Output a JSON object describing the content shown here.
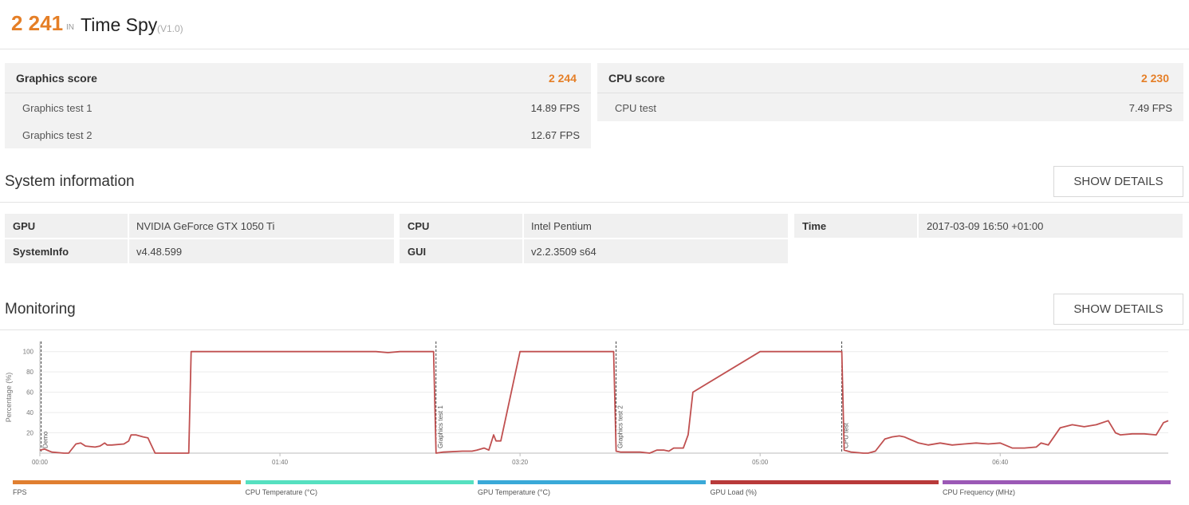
{
  "header": {
    "score": "2 241",
    "in_label": "IN",
    "title": "Time Spy",
    "version": "(V1.0)"
  },
  "graphics": {
    "label": "Graphics score",
    "value": "2 244",
    "tests": [
      {
        "label": "Graphics test 1",
        "value": "14.89 FPS"
      },
      {
        "label": "Graphics test 2",
        "value": "12.67 FPS"
      }
    ]
  },
  "cpu": {
    "label": "CPU score",
    "value": "2 230",
    "tests": [
      {
        "label": "CPU test",
        "value": "7.49 FPS"
      }
    ]
  },
  "system": {
    "title": "System information",
    "button": "SHOW DETAILS",
    "items": [
      {
        "key": "GPU",
        "value": "NVIDIA GeForce GTX 1050 Ti"
      },
      {
        "key": "CPU",
        "value": "Intel Pentium"
      },
      {
        "key": "Time",
        "value": "2017-03-09 16:50 +01:00"
      },
      {
        "key": "SystemInfo",
        "value": "v4.48.599"
      },
      {
        "key": "GUI",
        "value": "v2.2.3509 s64"
      }
    ]
  },
  "monitoring": {
    "title": "Monitoring",
    "button": "SHOW DETAILS",
    "legend": [
      {
        "label": "FPS",
        "color": "#e07f30"
      },
      {
        "label": "CPU Temperature (°C)",
        "color": "#56e0c0"
      },
      {
        "label": "GPU Temperature (°C)",
        "color": "#3aa9d8"
      },
      {
        "label": "GPU Load (%)",
        "color": "#b83a3a"
      },
      {
        "label": "CPU Frequency (MHz)",
        "color": "#9b59b6"
      }
    ]
  },
  "chart_data": {
    "type": "line",
    "ylabel": "Percentage (%)",
    "ylim": [
      0,
      110
    ],
    "yticks": [
      20,
      40,
      60,
      80,
      100
    ],
    "xlim": [
      0,
      470
    ],
    "xticks": [
      {
        "t": 0,
        "label": "00:00"
      },
      {
        "t": 100,
        "label": "01:40"
      },
      {
        "t": 200,
        "label": "03:20"
      },
      {
        "t": 300,
        "label": "05:00"
      },
      {
        "t": 400,
        "label": "06:40"
      }
    ],
    "markers": [
      {
        "t": 0.5,
        "label": "Demo"
      },
      {
        "t": 165,
        "label": "Graphics test 1"
      },
      {
        "t": 240,
        "label": "Graphics test 2"
      },
      {
        "t": 334,
        "label": "CPU test"
      }
    ],
    "grid": true,
    "series": [
      {
        "name": "GPU Load (%)",
        "color": "#c05050",
        "x": [
          0,
          2,
          4,
          5,
          10,
          12,
          15,
          17,
          19,
          23,
          25,
          27,
          28,
          30,
          35,
          37,
          38,
          40,
          43,
          45,
          48,
          53,
          55,
          60,
          62,
          63,
          65,
          80,
          90,
          100,
          140,
          145,
          150,
          155,
          163,
          164,
          165,
          168,
          176,
          180,
          182,
          185,
          187,
          189,
          190,
          192,
          200,
          220,
          238,
          239,
          240,
          242,
          250,
          254,
          257,
          260,
          262,
          264,
          268,
          270,
          272,
          300,
          333,
          334,
          335,
          338,
          343,
          345,
          348,
          352,
          355,
          358,
          360,
          363,
          366,
          370,
          375,
          380,
          385,
          390,
          395,
          400,
          405,
          410,
          415,
          417,
          420,
          425,
          430,
          435,
          440,
          445,
          448,
          450,
          455,
          460,
          465,
          468,
          470
        ],
        "y": [
          3,
          4,
          2,
          1,
          0,
          0,
          9,
          10,
          7,
          6,
          7,
          10,
          8,
          8,
          9,
          12,
          18,
          18,
          16,
          15,
          0,
          0,
          0,
          0,
          0,
          100,
          100,
          100,
          100,
          100,
          100,
          99,
          100,
          100,
          100,
          100,
          0,
          1,
          2,
          2,
          3,
          5,
          3,
          18,
          12,
          12,
          100,
          100,
          100,
          100,
          2,
          1,
          1,
          0,
          3,
          3,
          2,
          5,
          5,
          18,
          60,
          100,
          100,
          100,
          3,
          1,
          0,
          0,
          2,
          14,
          16,
          17,
          16,
          13,
          10,
          8,
          10,
          8,
          9,
          10,
          9,
          10,
          5,
          5,
          6,
          10,
          8,
          25,
          28,
          26,
          28,
          32,
          20,
          18,
          19,
          19,
          18,
          30,
          32
        ]
      }
    ]
  }
}
